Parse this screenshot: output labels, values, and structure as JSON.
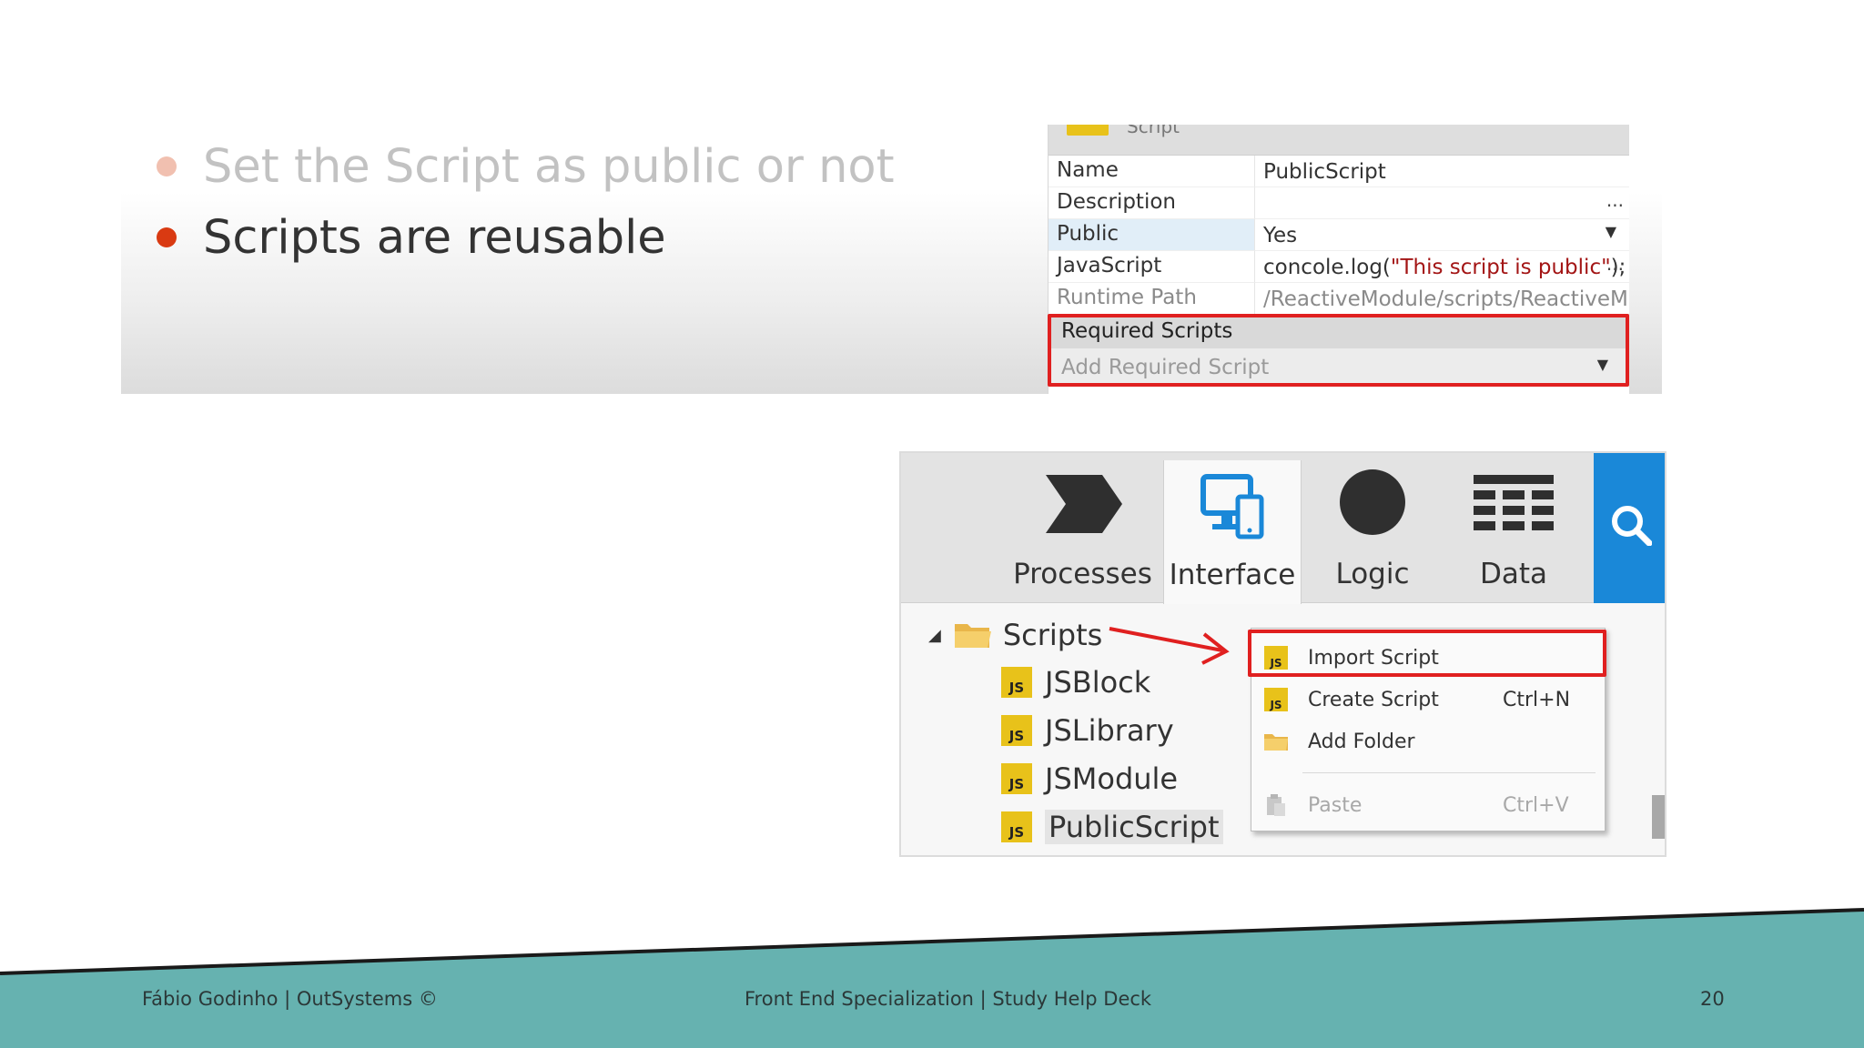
{
  "slide": {
    "bullets": [
      {
        "text": "Set the Script as public or not",
        "state": "dimmed"
      },
      {
        "text": "Scripts are reusable",
        "state": "active"
      }
    ]
  },
  "properties": {
    "header_tab": "Script",
    "rows": [
      {
        "key": "Name",
        "value": "PublicScript"
      },
      {
        "key": "Description",
        "value": "",
        "ellipsis": "..."
      },
      {
        "key": "Public",
        "value": "Yes"
      },
      {
        "key": "JavaScript",
        "value_prefix": "concole.log(",
        "value_string": "\"This script is public\"",
        "value_suffix": ");",
        "ellipsis": "..."
      },
      {
        "key": "Runtime Path",
        "value": "/ReactiveModule/scripts/ReactiveModu"
      }
    ],
    "required_scripts_label": "Required Scripts",
    "add_required_script": "Add Required Script"
  },
  "toolbar": {
    "tabs": [
      {
        "label": "Processes",
        "icon": "processes-chevron-icon"
      },
      {
        "label": "Interface",
        "icon": "interface-devices-icon",
        "active": true
      },
      {
        "label": "Logic",
        "icon": "logic-circle-icon"
      },
      {
        "label": "Data",
        "icon": "data-grid-icon"
      }
    ],
    "search_icon": "search-icon",
    "accent": "#1a88d8"
  },
  "tree": {
    "folder": "Scripts",
    "items": [
      "JSBlock",
      "JSLibrary",
      "JSModule",
      "PublicScript"
    ],
    "selected": "PublicScript",
    "icon_text": "JS"
  },
  "context_menu": {
    "items": [
      {
        "label": "Import Script",
        "shortcut": "",
        "icon": "js-icon"
      },
      {
        "label": "Create Script",
        "shortcut": "Ctrl+N",
        "icon": "js-icon"
      },
      {
        "label": "Add Folder",
        "shortcut": "",
        "icon": "folder-icon"
      },
      {
        "label": "Paste",
        "shortcut": "Ctrl+V",
        "icon": "paste-icon",
        "disabled": true
      }
    ]
  },
  "footer": {
    "left": "Fábio Godinho | OutSystems ©",
    "center": "Front End Specialization | Study Help Deck",
    "page": "20"
  },
  "colors": {
    "footer_teal": "#66b2b0",
    "highlight_red": "#e02020",
    "bullet_active": "#d93a12",
    "js_yellow": "#e8c21a"
  }
}
